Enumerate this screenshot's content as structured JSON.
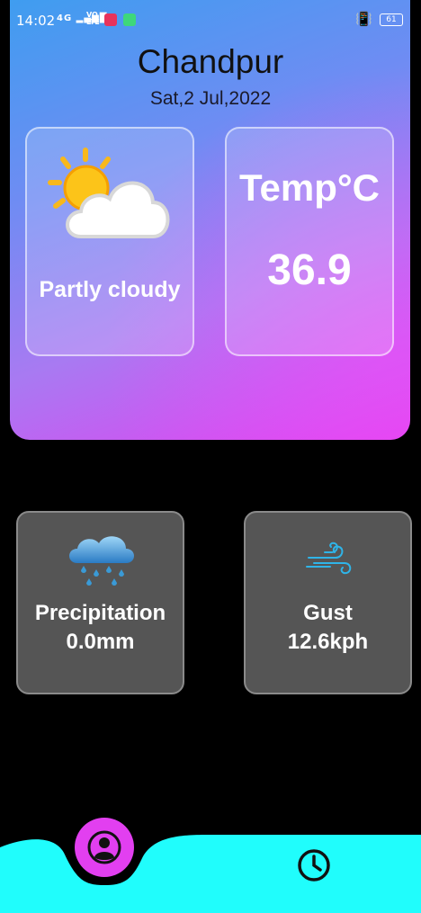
{
  "status_bar": {
    "time": "14:02",
    "network": "4G",
    "volte": "VO LTE",
    "battery": "61"
  },
  "location": {
    "city": "Chandpur",
    "date": "Sat,2 Jul,2022"
  },
  "current": {
    "condition": "Partly cloudy",
    "temp_label": "Temp°C",
    "temp_value": "36.9"
  },
  "details": {
    "precipitation_label": "Precipitation",
    "precipitation_value": "0.0mm",
    "gust_label": "Gust",
    "gust_value": "12.6kph"
  },
  "nav": {
    "icons": [
      "profile-icon",
      "clock-icon"
    ],
    "accent": "#e23ff0",
    "bar_color": "#20fdfc"
  }
}
